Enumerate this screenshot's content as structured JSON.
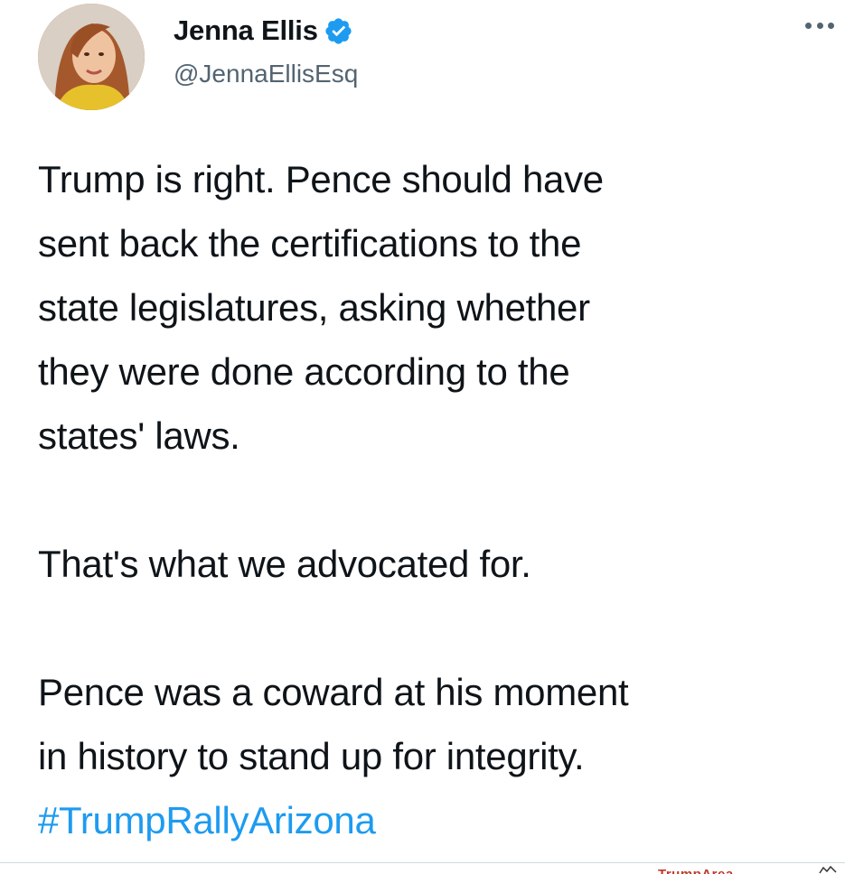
{
  "author": {
    "display_name": "Jenna Ellis",
    "handle": "@JennaEllisEsq",
    "verified": true
  },
  "tweet": {
    "paragraph_1": [
      "Trump is right. Pence should have",
      "sent back the certifications to the",
      "state legislatures, asking whether",
      "they were done according to the",
      "states' laws."
    ],
    "paragraph_2": "That's what we advocated for.",
    "paragraph_3": [
      "Pence was a coward at his moment",
      "in history to stand up for integrity."
    ],
    "hashtag": "#TrumpRallyArizona"
  },
  "icons": {
    "verified": "verified-badge-icon",
    "more": "more-options-icon"
  },
  "colors": {
    "text": "#0f1419",
    "secondary": "#536471",
    "link": "#1d9bf0"
  },
  "watermark": "TrumpArea"
}
